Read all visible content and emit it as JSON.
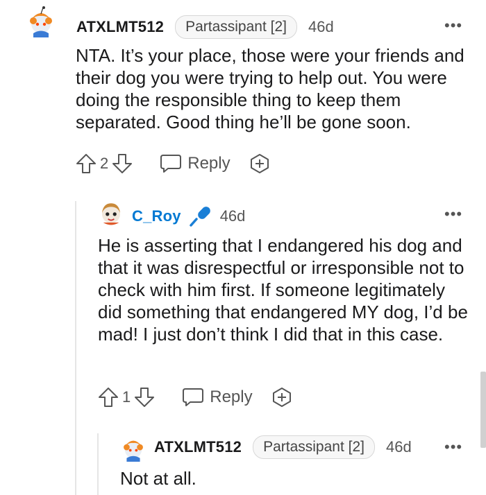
{
  "comments": [
    {
      "username": "ATXLMT512",
      "flair": "Partassipant [2]",
      "time": "46d",
      "more": "•••",
      "body": "NTA. It’s your place, those were your friends and their dog you were trying to help out. You were doing the responsible thing to keep them separated. Good thing he’ll be gone soon.",
      "votes": "2",
      "reply_label": "Reply"
    },
    {
      "username": "C_Roy",
      "time": "46d",
      "more": "•••",
      "body": "He is asserting that I endangered his dog and that it was disrespectful or irresponsible not to check with him first. If someone legitimately did something that endangered MY dog, I’d be mad! I just don’t think I did that in this case.",
      "votes": "1",
      "reply_label": "Reply"
    },
    {
      "username": "ATXLMT512",
      "flair": "Partassipant [2]",
      "time": "46d",
      "more": "•••",
      "body": "Not at all."
    }
  ],
  "colors": {
    "op_blue": "#0079d3",
    "text": "#1a1a1b",
    "meta": "#555555"
  },
  "icons": [
    "snoo-avatar-icon",
    "microphone-icon",
    "upvote-icon",
    "downvote-icon",
    "comment-bubble-icon",
    "award-plus-icon",
    "more-options-icon"
  ]
}
